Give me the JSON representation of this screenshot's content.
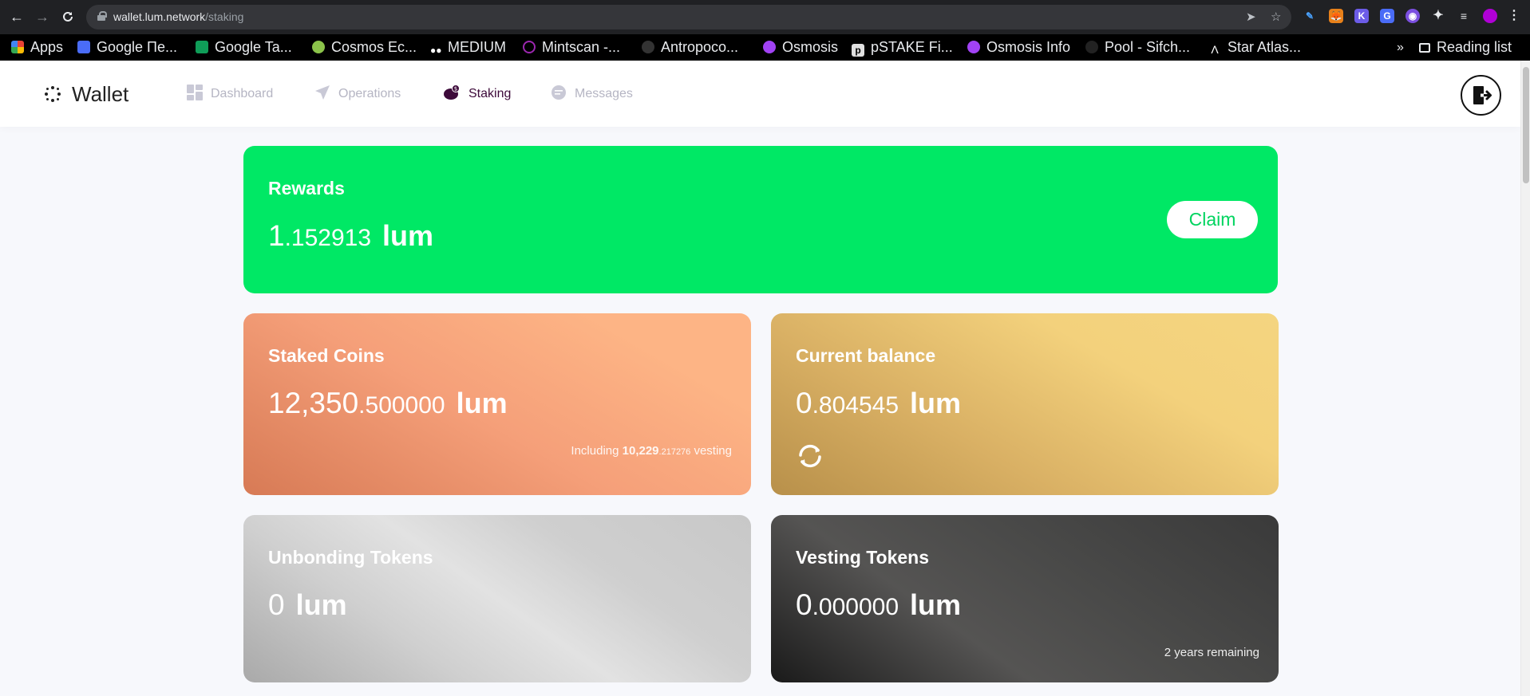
{
  "browser": {
    "url_host": "wallet.lum.network",
    "url_path": "/staking",
    "bookmarks": [
      {
        "label": "Apps",
        "color": "#ea4335"
      },
      {
        "label": "Google Пе...",
        "color": "#4a6cf7"
      },
      {
        "label": "Google Ta...",
        "color": "#0f9d58"
      },
      {
        "label": "Cosmos Ec...",
        "color": "#8bc34a"
      },
      {
        "label": "MEDIUM",
        "color": "#ffffff"
      },
      {
        "label": "Mintscan -...",
        "color": "#9c27b0"
      },
      {
        "label": "Antropoco...",
        "color": "#333333"
      },
      {
        "label": "Osmosis",
        "color": "#a142f4"
      },
      {
        "label": "pSTAKE Fi...",
        "color": "#e0e0e0"
      },
      {
        "label": "Osmosis Info",
        "color": "#a142f4"
      },
      {
        "label": "Pool - Sifch...",
        "color": "#222222"
      },
      {
        "label": "Star Atlas...",
        "color": "#ffffff"
      }
    ],
    "more": "»",
    "reading_list": "Reading list"
  },
  "app": {
    "logo": "Wallet",
    "nav": {
      "dashboard": "Dashboard",
      "operations": "Operations",
      "staking": "Staking",
      "messages": "Messages"
    }
  },
  "cards": {
    "rewards": {
      "title": "Rewards",
      "int": "1",
      "dec": ".152913",
      "unit": "lum",
      "claim": "Claim"
    },
    "staked": {
      "title": "Staked Coins",
      "int": "12,350",
      "dec": ".500000",
      "unit": "lum",
      "sub_prefix": "Including",
      "sub_int": "10,229",
      "sub_dec": ".217276",
      "sub_suffix": "vesting"
    },
    "balance": {
      "title": "Current balance",
      "int": "0",
      "dec": ".804545",
      "unit": "lum"
    },
    "unbonding": {
      "title": "Unbonding Tokens",
      "int": "0",
      "unit": "lum"
    },
    "vesting": {
      "title": "Vesting Tokens",
      "int": "0",
      "dec": ".000000",
      "unit": "lum",
      "remaining": "2 years remaining"
    }
  },
  "colors": {
    "rewards": "#00e865",
    "accent_nav": "#3d0a3a"
  }
}
